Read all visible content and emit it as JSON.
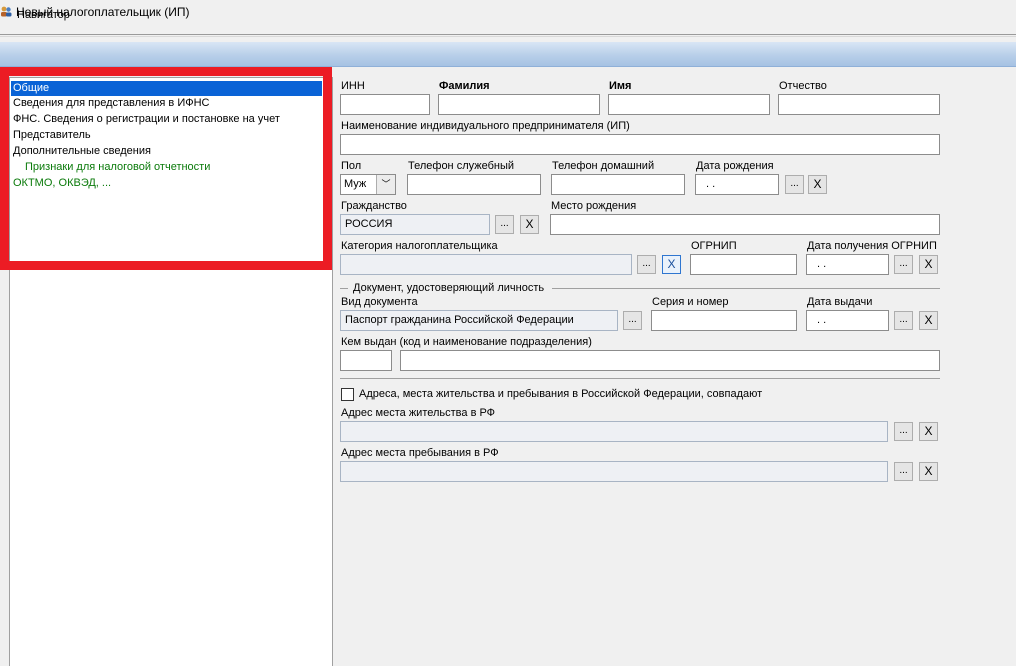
{
  "menu": {
    "navigator": "Навигатор"
  },
  "window": {
    "title": "Новый налогоплательщик (ИП)"
  },
  "nav": {
    "items": [
      "Общие",
      "Сведения для представления в ИФНС",
      "ФНС. Сведения о регистрации и постановке на учет",
      "Представитель",
      "Дополнительные сведения",
      "Признаки для налоговой отчетности",
      "ОКТМО, ОКВЭД, ..."
    ]
  },
  "form": {
    "inn_label": "ИНН",
    "surname_label": "Фамилия",
    "name_label": "Имя",
    "patronymic_label": "Отчество",
    "ip_name_label": "Наименование индивидуального предпринимателя (ИП)",
    "sex_label": "Пол",
    "sex_value": "Муж",
    "work_phone_label": "Телефон служебный",
    "home_phone_label": "Телефон домашний",
    "birth_date_label": "Дата рождения",
    "birth_date_value": ". .",
    "citizenship_label": "Гражданство",
    "citizenship_value": "РОССИЯ",
    "birth_place_label": "Место рождения",
    "category_label": "Категория налогоплательщика",
    "ogrnip_label": "ОГРНИП",
    "ogrnip_date_label": "Дата получения ОГРНИП",
    "ogrnip_date_value": ". .",
    "doc_group_label": "Документ, удостоверяющий личность",
    "doc_type_label": "Вид документа",
    "doc_type_value": "Паспорт гражданина Российской Федерации",
    "doc_number_label": "Серия и номер",
    "doc_date_label": "Дата выдачи",
    "doc_date_value": ". .",
    "issued_by_label": "Кем выдан (код и наименование подразделения)",
    "address_same_label": "Адреса, места жительства и пребывания в Российской Федерации, совпадают",
    "residence_label": "Адрес места жительства в РФ",
    "stay_label": "Адрес места пребывания в РФ",
    "browse_label": "...",
    "clear_label": "X",
    "combo_arrow": "﹀"
  }
}
